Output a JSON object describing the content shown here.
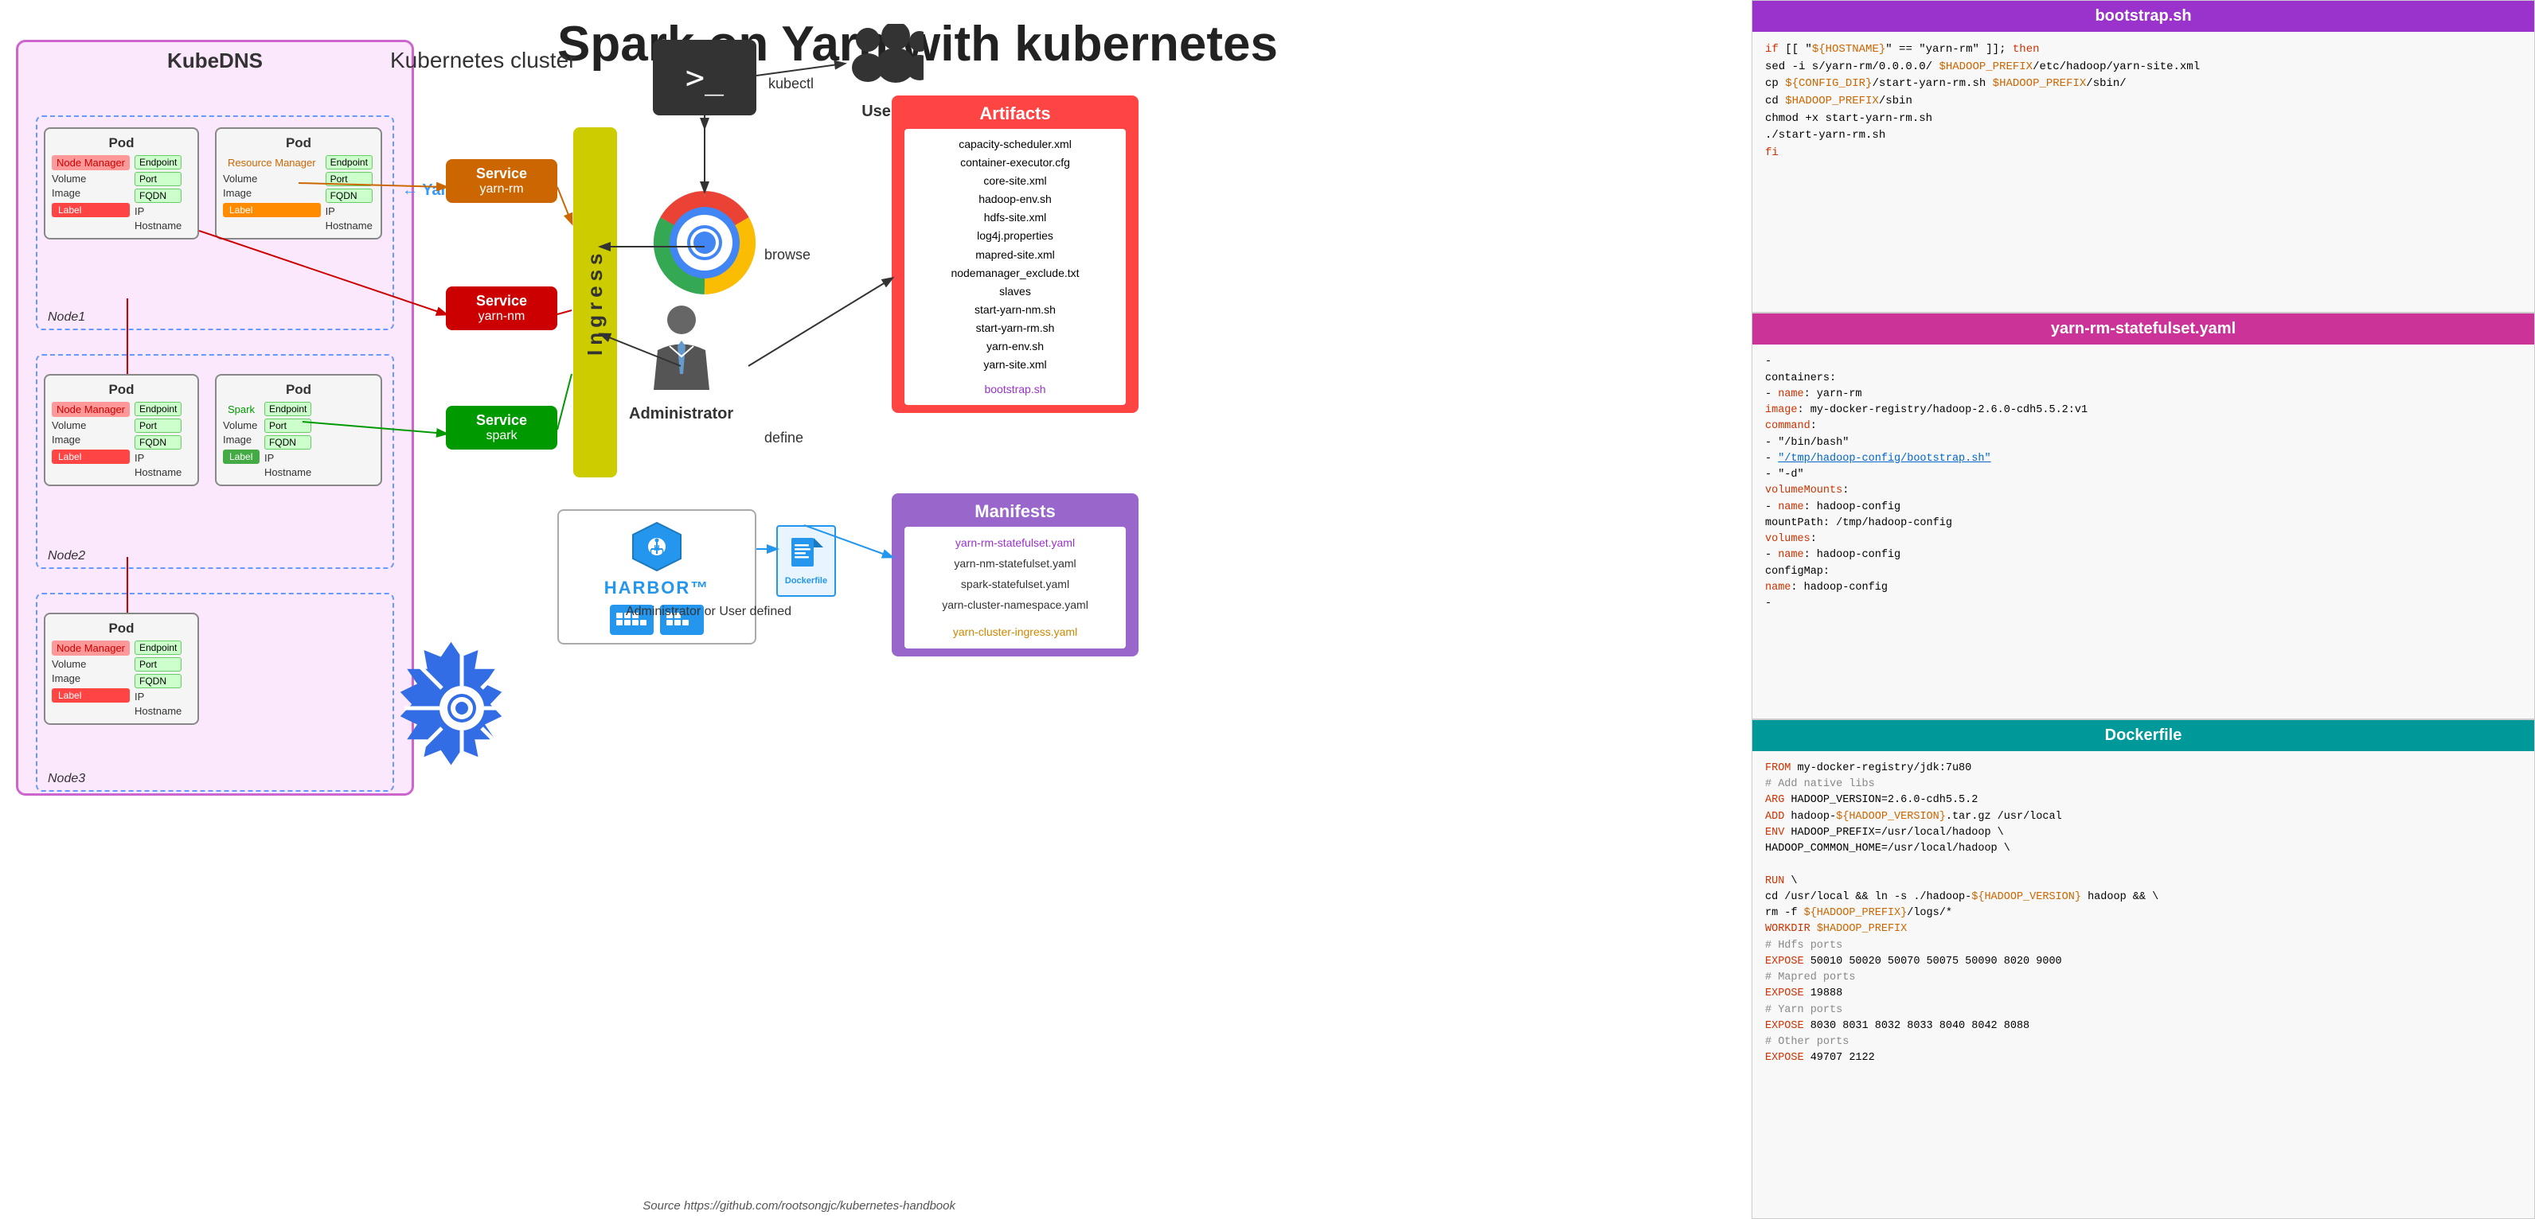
{
  "title": "Spark on Yarn with kubernetes",
  "kubedns": {
    "label": "KubeDNS"
  },
  "k8s": {
    "label": "Kubernetes cluster"
  },
  "yarn_cluster": "← Yarn Cluster",
  "nodes": [
    {
      "name": "Node1",
      "pods": [
        {
          "label": "Pod",
          "manager": "Node Manager",
          "manager_type": "node",
          "fields": [
            "Volume",
            "Image"
          ],
          "endpoints": [
            "Endpoint",
            "Port",
            "FQDN",
            "IP",
            "Hostname"
          ],
          "label_color": "red",
          "label_text": "Label"
        },
        {
          "label": "Pod",
          "manager": "Resource Manager",
          "manager_type": "resource",
          "fields": [
            "Volume",
            "Image"
          ],
          "endpoints": [
            "Endpoint",
            "Port",
            "FQDN",
            "IP",
            "Hostname"
          ],
          "label_color": "orange",
          "label_text": "Label"
        }
      ]
    },
    {
      "name": "Node2",
      "pods": [
        {
          "label": "Pod",
          "manager": "Node Manager",
          "manager_type": "node",
          "fields": [
            "Volume",
            "Image"
          ],
          "endpoints": [
            "Endpoint",
            "Port",
            "FQDN",
            "IP",
            "Hostname"
          ],
          "label_color": "red",
          "label_text": "Label"
        },
        {
          "label": "Pod",
          "manager": "Spark",
          "manager_type": "spark",
          "fields": [
            "Volume",
            "Image"
          ],
          "endpoints": [
            "Endpoint",
            "Port",
            "FQDN",
            "IP",
            "Hostname"
          ],
          "label_color": "green",
          "label_text": "Label"
        }
      ]
    },
    {
      "name": "Node3",
      "pods": [
        {
          "label": "Pod",
          "manager": "Node Manager",
          "manager_type": "node",
          "fields": [
            "Volume",
            "Image"
          ],
          "endpoints": [
            "Endpoint",
            "Port",
            "FQDN",
            "IP",
            "Hostname"
          ],
          "label_color": "red",
          "label_text": "Label"
        }
      ]
    }
  ],
  "services": [
    {
      "name": "Service",
      "sub": "yarn-rm",
      "color": "#cc6600"
    },
    {
      "name": "Service",
      "sub": "yarn-nm",
      "color": "#cc0000"
    },
    {
      "name": "Service",
      "sub": "spark",
      "color": "#009900"
    }
  ],
  "ingress": "Ingress",
  "terminal_label": "kubectl",
  "browse_label": "browse",
  "define_label": "define",
  "users_label": "Users",
  "admin_label": "Administrator",
  "admin_or_user_label": "Administrator or User defined",
  "artifacts": {
    "title": "Artifacts",
    "items": [
      "capacity-scheduler.xml",
      "container-executor.cfg",
      "core-site.xml",
      "hadoop-env.sh",
      "hdfs-site.xml",
      "log4j.properties",
      "mapred-site.xml",
      "nodemanager_exclude.txt",
      "slaves",
      "start-yarn-nm.sh",
      "start-yarn-rm.sh",
      "yarn-env.sh",
      "yarn-site.xml",
      "",
      "bootstrap.sh"
    ]
  },
  "manifests": {
    "title": "Manifests",
    "items": [
      "yarn-rm-statefulset.yaml",
      "yarn-nm-statefulset.yaml",
      "spark-statefulset.yaml",
      "yarn-cluster-namespace.yaml",
      "",
      "yarn-cluster-ingress.yaml"
    ]
  },
  "bootstrap_sh": {
    "title": "bootstrap.sh",
    "lines": [
      "if [[ \"${HOSTNAME}\" == \"yarn-rm\" ]]; then",
      "  sed -i s/yarn-rm/0.0.0.0/ $HADOOP_PREFIX/etc/hadoop/yarn-site.xml",
      "  cp ${CONFIG_DIR}/start-yarn-rm.sh $HADOOP_PREFIX/sbin/",
      "  cd $HADOOP_PREFIX/sbin",
      "  chmod +x start-yarn-rm.sh",
      "  ./start-yarn-rm.sh",
      "fi"
    ]
  },
  "yarn_rm_yaml": {
    "title": "yarn-rm-statefulset.yaml",
    "lines": [
      "-",
      "  containers:",
      "  - name: yarn-rm",
      "    image: my-docker-registry/hadoop-2.6.0-cdh5.5.2:v1",
      "    command:",
      "      - \"/bin/bash\"",
      "      - \"/tmp/hadoop-config/bootstrap.sh\"",
      "      - \"-d\"",
      "    volumeMounts:",
      "      - name: hadoop-config",
      "        mountPath: /tmp/hadoop-config",
      "    volumes:",
      "      - name: hadoop-config",
      "        configMap:",
      "          name: hadoop-config",
      "-"
    ]
  },
  "dockerfile": {
    "title": "Dockerfile",
    "lines": [
      "FROM my-docker-registry/jdk:7u80",
      "# Add native libs",
      "ARG HADOOP_VERSION=2.6.0-cdh5.5.2",
      "ADD hadoop-${HADOOP_VERSION}.tar.gz /usr/local",
      "ENV HADOOP_PREFIX=/usr/local/hadoop \\",
      "    HADOOP_COMMON_HOME=/usr/local/hadoop \\",
      "",
      "RUN \\",
      "  cd /usr/local && ln -s ./hadoop-${HADOOP_VERSION} hadoop && \\",
      "  rm -f ${HADOOP_PREFIX}/logs/*",
      "WORKDIR $HADOOP_PREFIX",
      "# Hdfs ports",
      "EXPOSE 50010 50020 50070 50075 50090 8020 9000",
      "# Mapred ports",
      "EXPOSE 19888",
      "# Yarn ports",
      "EXPOSE 8030 8031 8032 8033 8040 8042 8088",
      "# Other ports",
      "EXPOSE 49707 2122"
    ]
  },
  "source_label": "Source https://github.com/rootsongjc/kubernetes-handbook"
}
